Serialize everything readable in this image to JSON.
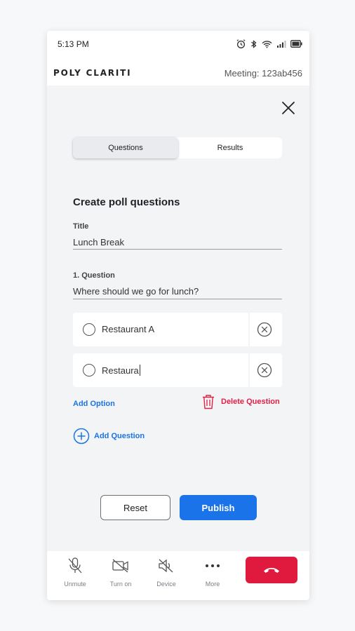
{
  "status_bar": {
    "time": "5:13 PM",
    "icons": [
      "alarm-icon",
      "bluetooth-icon",
      "wifi-icon",
      "signal-icon",
      "battery-icon"
    ]
  },
  "header": {
    "brand": "POLY CLARITI",
    "meeting": "Meeting: 123ab456"
  },
  "tabs": [
    {
      "label": "Questions",
      "active": true
    },
    {
      "label": "Results",
      "active": false
    }
  ],
  "poll": {
    "section_title": "Create poll questions",
    "title_label": "Title",
    "title_value": "Lunch Break",
    "question_label": "1. Question",
    "question_value": "Where should we go for lunch?",
    "options": [
      {
        "text": "Restaurant A"
      },
      {
        "text": "Restaura"
      }
    ],
    "add_option": "Add Option",
    "delete_question": "Delete Question",
    "add_question": "Add Question"
  },
  "actions": {
    "reset": "Reset",
    "publish": "Publish"
  },
  "bottom_bar": [
    {
      "label": "Unmute",
      "icon": "mic-off-icon"
    },
    {
      "label": "Turn on",
      "icon": "video-off-icon"
    },
    {
      "label": "Device",
      "icon": "speaker-off-icon"
    },
    {
      "label": "More",
      "icon": "more-icon"
    }
  ],
  "colors": {
    "accent": "#1a73e8",
    "danger": "#e02044",
    "end_call": "#e0193f"
  }
}
